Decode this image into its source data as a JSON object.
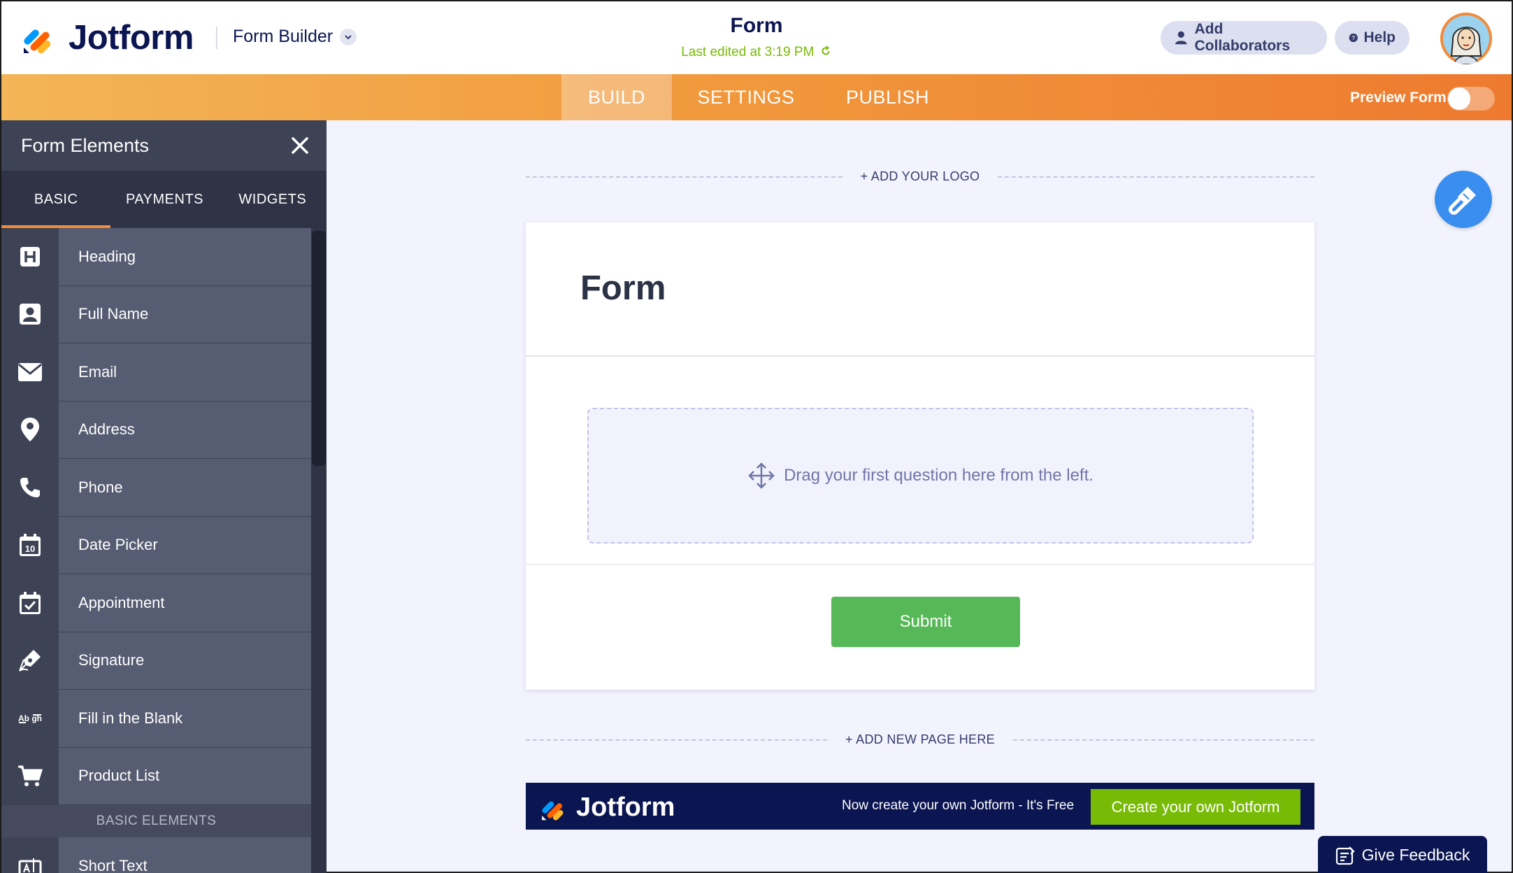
{
  "header": {
    "brand": "Jotform",
    "builder_label": "Form Builder",
    "form_title": "Form",
    "last_edited": "Last edited at 3:19 PM",
    "add_collaborators": "Add Collaborators",
    "help": "Help"
  },
  "nav": {
    "tabs": [
      "BUILD",
      "SETTINGS",
      "PUBLISH"
    ],
    "active_tab": "BUILD",
    "preview_label": "Preview Form",
    "preview_on": false
  },
  "sidebar": {
    "title": "Form Elements",
    "tabs": [
      "BASIC",
      "PAYMENTS",
      "WIDGETS"
    ],
    "items": [
      {
        "label": "Heading",
        "icon": "heading-icon"
      },
      {
        "label": "Full Name",
        "icon": "full-name-icon"
      },
      {
        "label": "Email",
        "icon": "email-icon"
      },
      {
        "label": "Address",
        "icon": "location-pin-icon"
      },
      {
        "label": "Phone",
        "icon": "phone-icon"
      },
      {
        "label": "Date Picker",
        "icon": "calendar-icon"
      },
      {
        "label": "Appointment",
        "icon": "appointment-icon"
      },
      {
        "label": "Signature",
        "icon": "signature-pen-icon"
      },
      {
        "label": "Fill in the Blank",
        "icon": "fill-blank-icon"
      },
      {
        "label": "Product List",
        "icon": "cart-icon"
      }
    ],
    "section_label": "BASIC ELEMENTS",
    "after_section": [
      {
        "label": "Short Text",
        "icon": "short-text-icon"
      }
    ],
    "date_icon_number": "10",
    "fill_blank_icon_text": "Ab gh"
  },
  "canvas": {
    "add_logo": "+ ADD YOUR LOGO",
    "form_heading": "Form",
    "drop_hint": "Drag your first question here from the left.",
    "submit": "Submit",
    "add_page": "+ ADD NEW PAGE HERE"
  },
  "promo": {
    "brand": "Jotform",
    "text": "Now create your own Jotform - It's Free",
    "button": "Create your own Jotform"
  },
  "feedback": "Give Feedback",
  "colors": {
    "orange": "#f08c3a",
    "navy": "#0a1551",
    "green": "#57b857",
    "lime": "#78bb07",
    "blue_fab": "#3a8ef0"
  }
}
